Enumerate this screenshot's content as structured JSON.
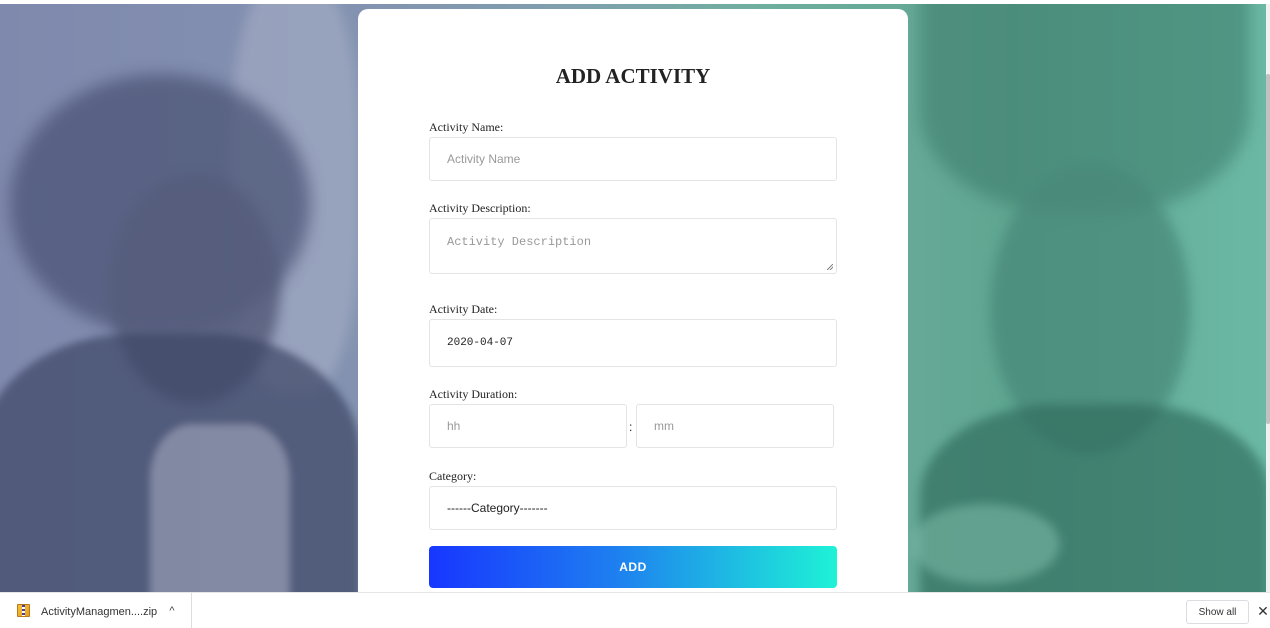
{
  "form": {
    "title": "ADD ACTIVITY",
    "activity_name": {
      "label": "Activity Name:",
      "placeholder": "Activity Name",
      "value": ""
    },
    "activity_description": {
      "label": "Activity Description:",
      "placeholder": "Activity Description",
      "value": ""
    },
    "activity_date": {
      "label": "Activity Date:",
      "value": "2020-04-07"
    },
    "activity_duration": {
      "label": "Activity Duration:",
      "hours_placeholder": "hh",
      "separator": ":",
      "minutes_placeholder": "mm"
    },
    "category": {
      "label": "Category:",
      "selected": "------Category-------"
    },
    "submit_label": "ADD",
    "button_gradient": [
      "#1836ff",
      "#1ef2d6"
    ]
  },
  "download_bar": {
    "file_name": "ActivityManagmen....zip",
    "chevron": "^",
    "show_all_label": "Show all",
    "close_glyph": "✕"
  }
}
